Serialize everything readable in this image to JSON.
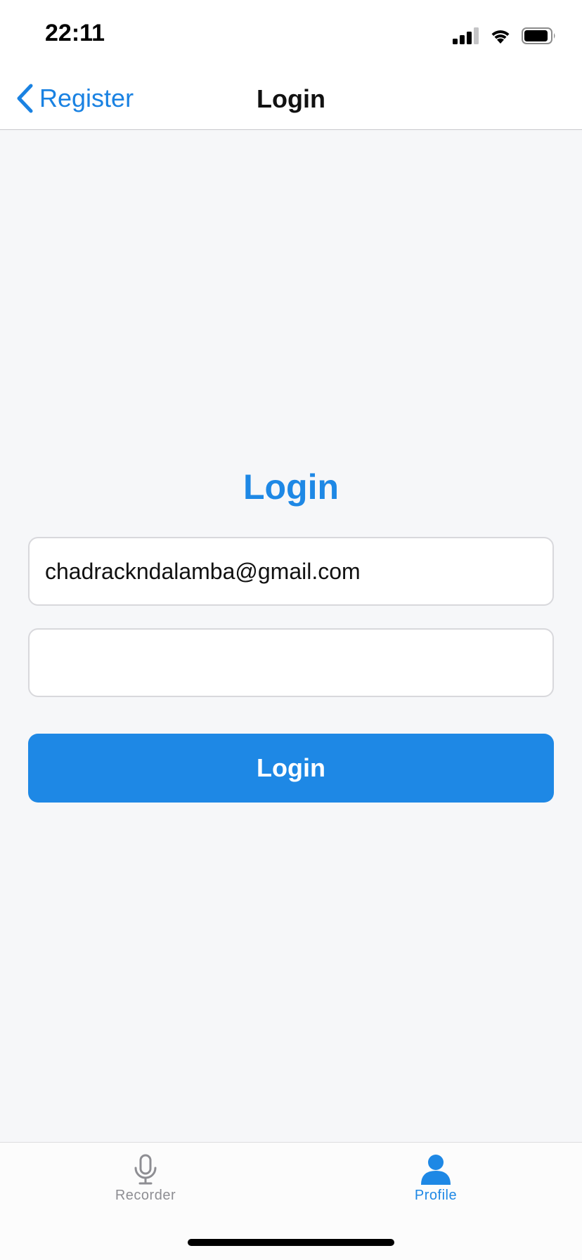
{
  "status_bar": {
    "time": "22:11"
  },
  "navbar": {
    "back_label": "Register",
    "title": "Login"
  },
  "form": {
    "heading": "Login",
    "email_value": "chadrackndalamba@gmail.com",
    "email_placeholder": "",
    "password_value": "",
    "password_placeholder": "",
    "submit_label": "Login"
  },
  "tabbar": {
    "tabs": [
      {
        "label": "Recorder",
        "icon": "microphone-icon",
        "active": false
      },
      {
        "label": "Profile",
        "icon": "person-icon",
        "active": true
      }
    ]
  },
  "colors": {
    "accent": "#1e88e5",
    "link": "#1a82e2",
    "inactive_tab": "#8e8e93",
    "background": "#f6f7f9"
  }
}
